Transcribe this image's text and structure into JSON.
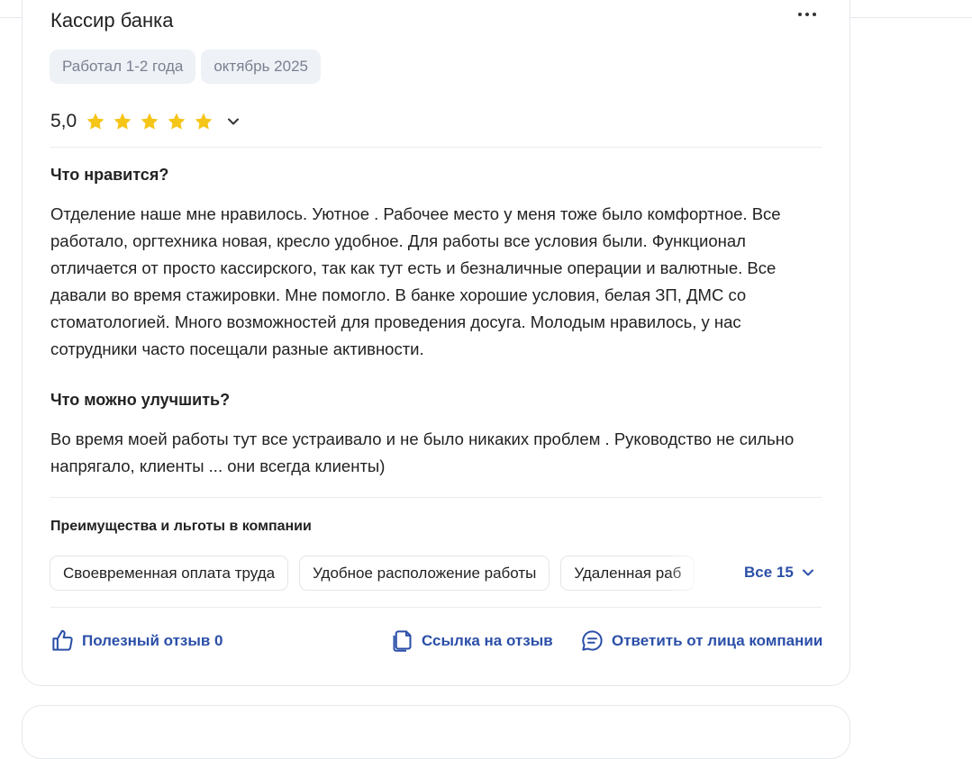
{
  "review": {
    "job_title": "Кассир банка",
    "tags": [
      "Работал 1-2 года",
      "октябрь 2025"
    ],
    "rating": "5,0",
    "stars": 5,
    "pros_heading": "Что нравится?",
    "pros_text": "Отделение наше мне нравилось. Уютное . Рабочее место у меня тоже было комфортное. Все работало, оргтехника новая, кресло удобное. Для работы все условия были. Функционал отличается от просто кассирского, так как тут есть и безналичные операции и валютные. Все давали во время стажировки. Мне помогло. В банке хорошие условия, белая ЗП, ДМС со стоматологией. Много возможностей для проведения досуга. Молодым нравилось, у нас сотрудники часто посещали разные активности.",
    "cons_heading": "Что можно улучшить?",
    "cons_text": "Во время моей работы тут все устраивало и не было никаких проблем . Руководство не сильно напрягало, клиенты ... они всегда клиенты)"
  },
  "benefits": {
    "heading": "Преимущества и льготы в компании",
    "items": [
      "Своевременная оплата труда",
      "Удобное расположение работы",
      "Удаленная раб"
    ],
    "all_label": "Все 15"
  },
  "actions": {
    "helpful": "Полезный отзыв 0",
    "link": "Ссылка на отзыв",
    "reply": "Ответить от лица компании"
  },
  "colors": {
    "accent": "#2b4fa8",
    "star": "#f5c518",
    "chip_bg": "#eef1f6",
    "primary_button": "#3f86f0"
  },
  "icons": [
    "more-icon",
    "star-icon",
    "chevron-down-icon",
    "thumb-up-icon",
    "copy-link-icon",
    "chat-icon"
  ]
}
